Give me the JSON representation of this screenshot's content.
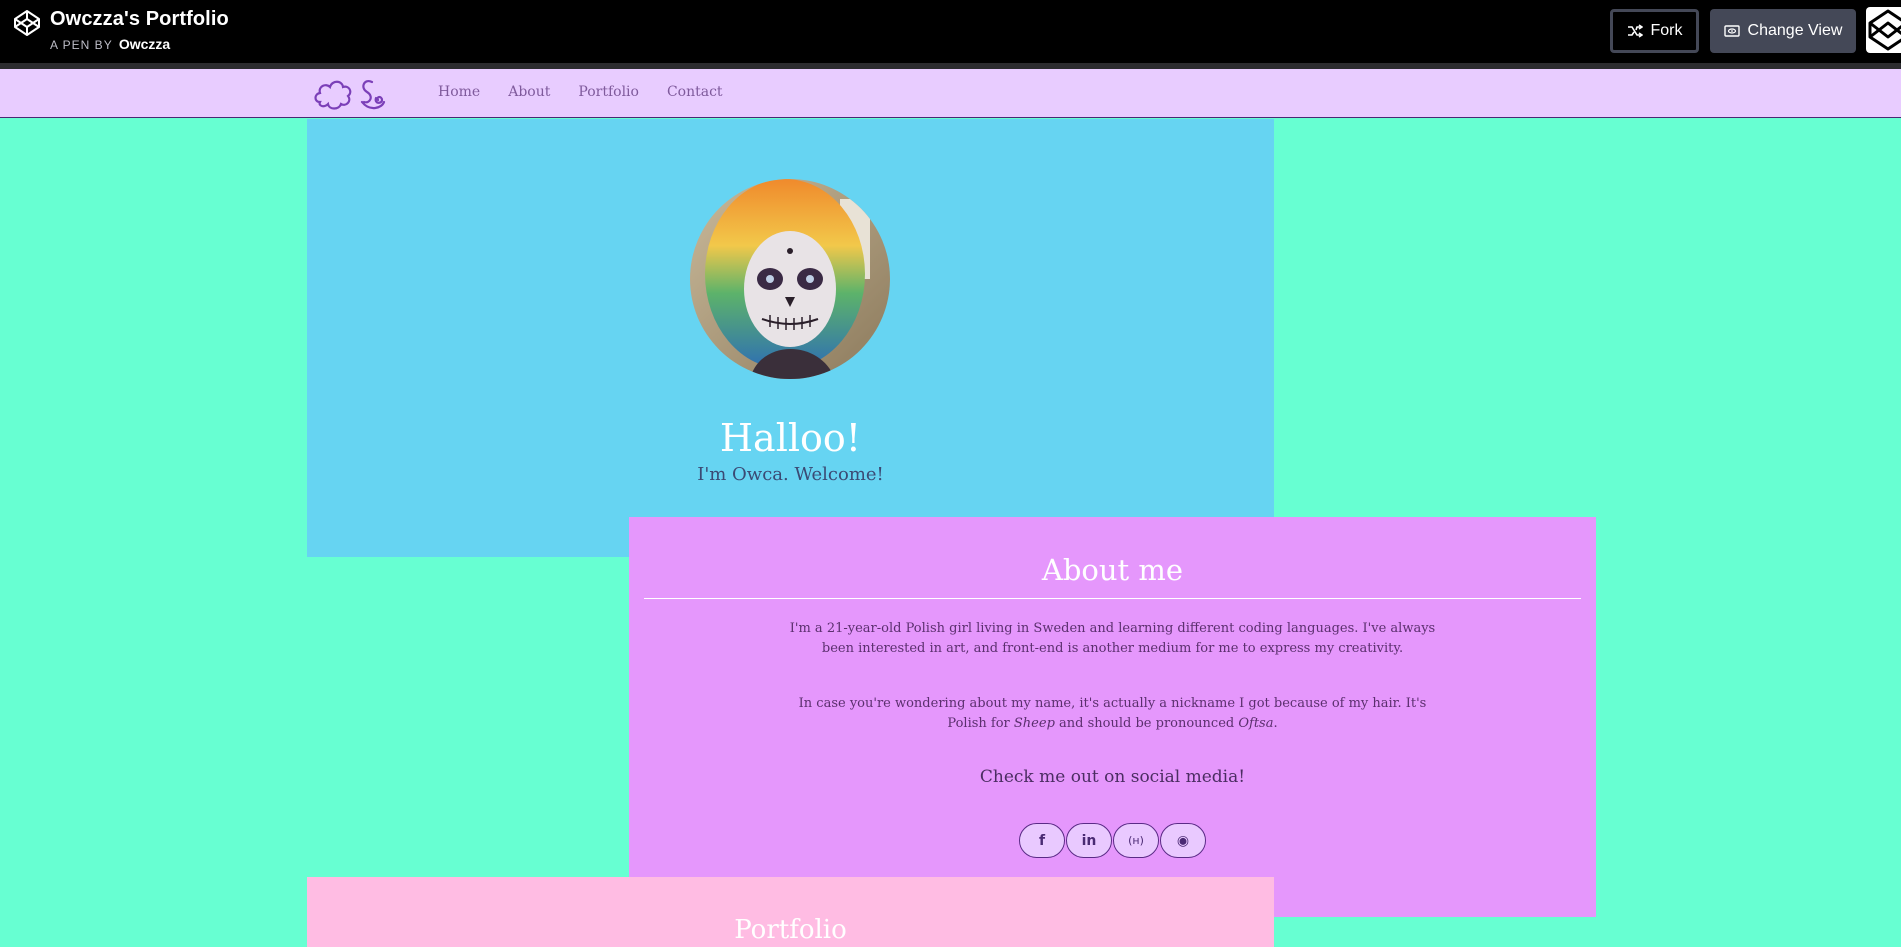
{
  "codepen": {
    "title": "Owczza's Portfolio",
    "pen_by": "A PEN BY",
    "author": "Owczza",
    "fork_label": "Fork",
    "change_view_label": "Change View",
    "icons": [
      "codepen-logo-icon",
      "fork-icon",
      "eye-icon"
    ]
  },
  "nav": {
    "links": [
      "Home",
      "About",
      "Portfolio",
      "Contact"
    ]
  },
  "hero": {
    "title": "Halloo!",
    "subtitle": "I'm Owca. Welcome!"
  },
  "about": {
    "title": "About me",
    "p1": "I'm a 21-year-old Polish girl living in Sweden and learning different coding languages. I've always been interested in art, and front-end is another medium for me to express my creativity.",
    "p2_before": "In case you're wondering about my name, it's actually a nickname I got because of my hair. It's Polish for ",
    "p2_sheep": "Sheep",
    "p2_middle": " and should be pronounced ",
    "p2_oftsa": "Oftsa",
    "p2_end": ".",
    "social_heading": "Check me out on social media!",
    "social": [
      {
        "name": "facebook-icon",
        "glyph": "f"
      },
      {
        "name": "linkedin-icon",
        "glyph": "in"
      },
      {
        "name": "freecodecamp-icon",
        "glyph": "(ʜ)"
      },
      {
        "name": "github-icon",
        "glyph": "◉"
      }
    ]
  },
  "portfolio": {
    "title": "Portfolio"
  },
  "colors": {
    "page_bg": "#67ffd2",
    "nav_bg": "#e8ccff",
    "hero_bg": "#66d4f2",
    "about_bg": "#e597fc",
    "portfolio_bg": "#ffbce3"
  }
}
